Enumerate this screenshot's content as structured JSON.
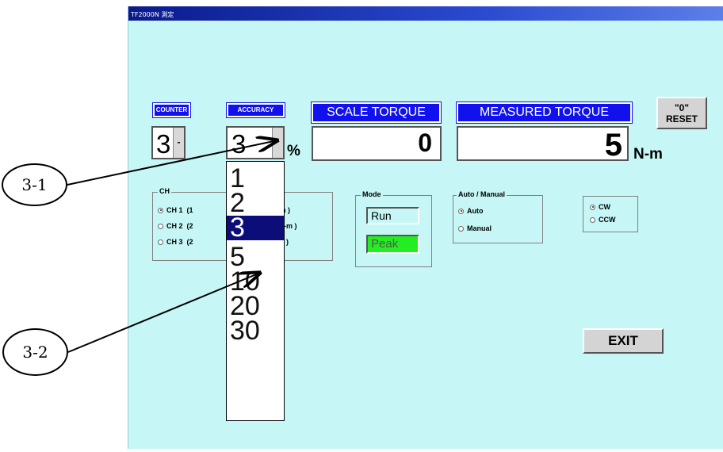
{
  "window": {
    "title": "TF2000N 測定"
  },
  "counter": {
    "header": "COUNTER",
    "value": "3"
  },
  "accuracy": {
    "header": "ACCURACY",
    "value": "3",
    "unit": "%",
    "options": [
      "1",
      "2",
      "3",
      "5",
      "10",
      "20",
      "30"
    ],
    "selected_index": 2
  },
  "scale_torque": {
    "header": "SCALE TORQUE",
    "value": "0"
  },
  "measured_torque": {
    "header": "MEASURED  TORQUE",
    "value": "5",
    "unit": "N-m"
  },
  "reset_button": {
    "line1": "\"0\"",
    "line2": "RESET"
  },
  "ch_group": {
    "legend": "CH",
    "items": [
      {
        "label": "CH 1  (1",
        "suffix": "N-m )",
        "selected": true
      },
      {
        "label": "CH 2  (2",
        "suffix": "-m )",
        "selected": false
      },
      {
        "label": "CH 3  (2",
        "suffix": ")",
        "selected": false
      }
    ]
  },
  "mode_group": {
    "legend": "Mode",
    "run_label": "Run",
    "peak_label": "Peak",
    "peak_color": "#22ee22"
  },
  "auto_manual_group": {
    "legend": "Auto / Manual",
    "items": [
      {
        "label": "Auto",
        "selected": true
      },
      {
        "label": "Manual",
        "selected": false
      }
    ]
  },
  "direction_group": {
    "items": [
      {
        "label": "CW",
        "selected": true
      },
      {
        "label": "CCW",
        "selected": false
      }
    ]
  },
  "exit_button": {
    "label": "EXIT"
  },
  "callouts": {
    "c1": "3-1",
    "c2": "3-2"
  },
  "colors": {
    "background": "#c6f6f6",
    "header_blue": "#1111ee",
    "selection": "#0d0d7a"
  }
}
